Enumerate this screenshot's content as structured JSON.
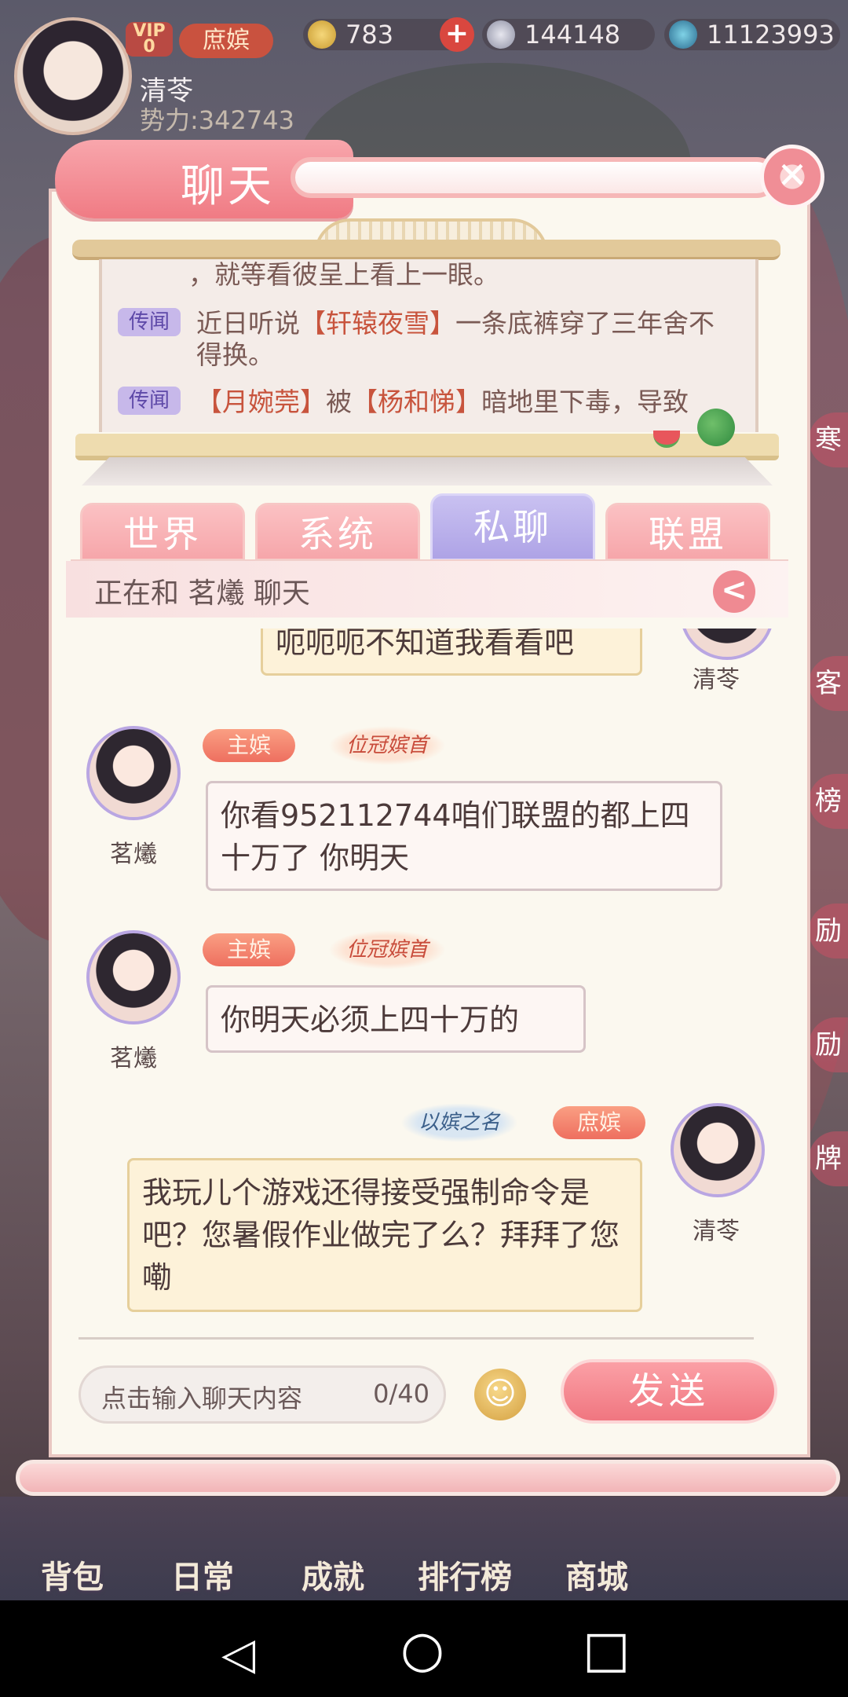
{
  "hud": {
    "vip_label": "VIP",
    "vip_level": "0",
    "rank": "庶嫔",
    "gold": "783",
    "plus": "+",
    "silver": "144148",
    "gems": "11123993",
    "player_name": "清苓",
    "power": "势力:342743"
  },
  "panel": {
    "title": "聊天",
    "close": "✕"
  },
  "news": {
    "partial_line": "，就等看彼呈上看上一眼。",
    "items": [
      {
        "tag": "传闻",
        "before": "近日听说",
        "highlight": "【轩辕夜雪】",
        "after": "一条底裤穿了三年舍不得换。"
      },
      {
        "tag": "传闻",
        "highlight": "【月婉莞】",
        "middle": "被",
        "highlight2": "【杨和悌】",
        "after": "暗地里下毒，导致"
      }
    ]
  },
  "tabs": [
    "世界",
    "系统",
    "私聊",
    "联盟"
  ],
  "active_tab": "私聊",
  "chat_status": "正在和 茗爔 聊天",
  "back_icon": "<",
  "messages": [
    {
      "side": "right",
      "name": "清苓",
      "text": "呃呃呃不知道我看看吧"
    },
    {
      "side": "left",
      "name": "茗爔",
      "rank": "主嫔",
      "title": "位冠嫔首",
      "text": "你看952112744咱们联盟的都上四十万了 你明天"
    },
    {
      "side": "left",
      "name": "茗爔",
      "rank": "主嫔",
      "title": "位冠嫔首",
      "text": "你明天必须上四十万的"
    },
    {
      "side": "right",
      "name": "清苓",
      "rank": "庶嫔",
      "title": "以嫔之名",
      "text": "我玩儿个游戏还得接受强制命令是吧？您暑假作业做完了么？拜拜了您嘞"
    }
  ],
  "input": {
    "placeholder": "点击输入聊天内容",
    "count": "0/40",
    "send": "发送",
    "emoji": "☺"
  },
  "bottom_nav": [
    "背包",
    "日常",
    "成就",
    "排行榜",
    "商城"
  ],
  "side_icons": [
    "寒",
    "客",
    "榜",
    "励",
    "励",
    "牌"
  ],
  "sys_nav": {
    "back": "◁",
    "home": "○",
    "recent": "□"
  },
  "colors": {
    "accent": "#f07b84",
    "tab_active": "#aea3e6",
    "highlight": "#c8543d"
  }
}
